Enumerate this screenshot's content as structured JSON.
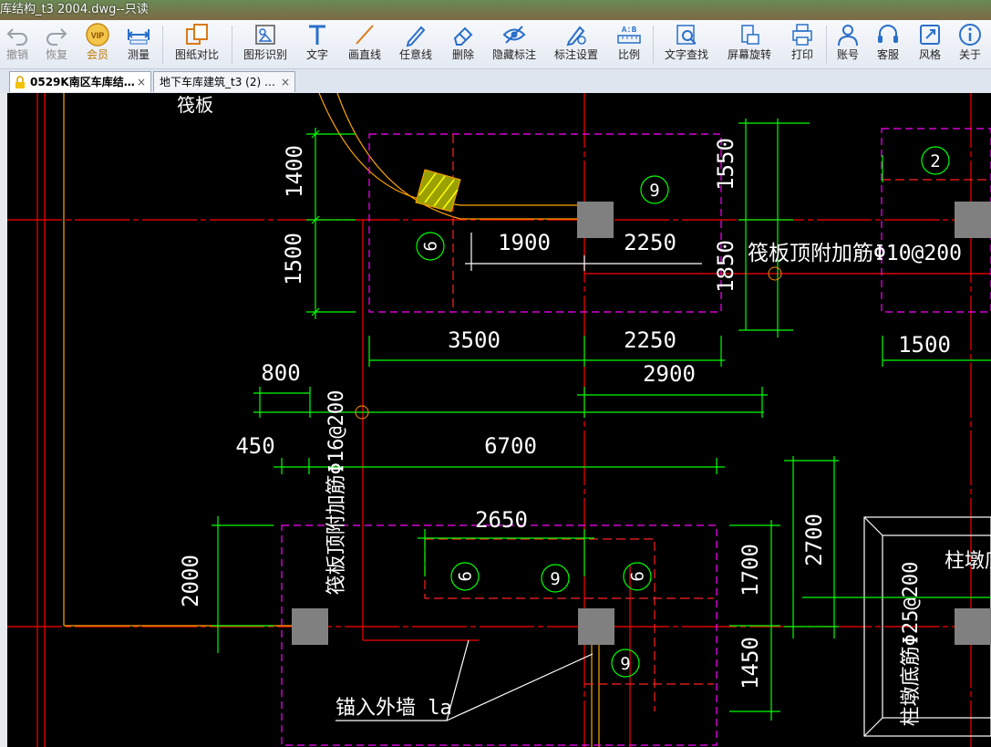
{
  "window": {
    "title": "库结构_t3 2004.dwg--只读"
  },
  "toolbar": {
    "items": [
      {
        "label": "撤销",
        "icon": "undo-icon"
      },
      {
        "label": "恢复",
        "icon": "redo-icon"
      },
      {
        "label": "会员",
        "icon": "vip-icon",
        "badge": "VIP"
      },
      {
        "label": "测量",
        "icon": "measure-icon"
      },
      {
        "label": "图纸对比",
        "icon": "compare-icon"
      },
      {
        "label": "图形识别",
        "icon": "shape-recognize-icon"
      },
      {
        "label": "文字",
        "icon": "text-icon"
      },
      {
        "label": "画直线",
        "icon": "line-icon"
      },
      {
        "label": "任意线",
        "icon": "freehand-icon"
      },
      {
        "label": "删除",
        "icon": "eraser-icon"
      },
      {
        "label": "隐藏标注",
        "icon": "eye-hide-icon"
      },
      {
        "label": "标注设置",
        "icon": "annotation-settings-icon"
      },
      {
        "label": "比例",
        "icon": "scale-icon",
        "badge": "A:B"
      },
      {
        "label": "文字查找",
        "icon": "text-search-icon"
      },
      {
        "label": "屏幕旋转",
        "icon": "rotate-screen-icon"
      },
      {
        "label": "打印",
        "icon": "print-icon"
      },
      {
        "label": "账号",
        "icon": "account-icon"
      },
      {
        "label": "客服",
        "icon": "headset-icon"
      },
      {
        "label": "风格",
        "icon": "style-icon"
      },
      {
        "label": "关于",
        "icon": "info-icon"
      }
    ]
  },
  "tabs": [
    {
      "label": "0529K南区车库结…",
      "active": true,
      "locked": true,
      "close": "×"
    },
    {
      "label": "地下车库建筑_t3 (2) …",
      "active": false,
      "locked": false,
      "close": "×"
    }
  ],
  "drawing": {
    "colors": {
      "background": "#000000",
      "grid": "#ff0000",
      "dimension": "#00ff00",
      "text": "#ffffff",
      "region": "#ff00ff",
      "column": "#808080",
      "wall": "#ffa500",
      "tag": "#00ff00"
    },
    "texts": {
      "raft": "筏板",
      "raft_top_rebar_10": "筏板顶附加筋Φ10@200",
      "raft_top_rebar_16": "筏板顶附加筋Φ16@200",
      "pier_bottom_rebar": "柱墩底筋Φ25@200",
      "pier_bottom": "柱墩底",
      "anchor_wall": "锚入外墙 la"
    },
    "dims": {
      "d1400": "1400",
      "d1500a": "1500",
      "d1900": "1900",
      "d2250a": "2250",
      "d1550": "1550",
      "d1850": "1850",
      "d3500": "3500",
      "d2250b": "2250",
      "d1500b": "1500",
      "d800": "800",
      "d2900": "2900",
      "d450": "450",
      "d6700": "6700",
      "d2650": "2650",
      "d2000": "2000",
      "d1700": "1700",
      "d2700": "2700",
      "d1450": "1450"
    },
    "tags": {
      "t9": "9",
      "t2": "2"
    }
  }
}
